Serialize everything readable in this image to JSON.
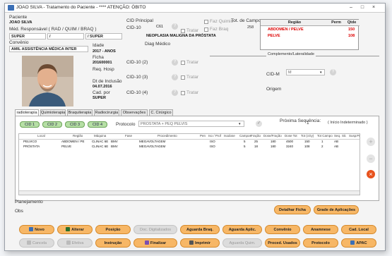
{
  "window": {
    "title": "JOAO SILVA - Tratamento do Paciente - **** ATENÇÃO: ÓBITO"
  },
  "patient": {
    "label": "Paciente",
    "name": "JOAO SILVA",
    "med_label": "Méd. Responsável ( RAD / QUIM / BRAQ )",
    "med1": "SUPER",
    "med2": "/",
    "med3": "/ SUPER",
    "convenio_label": "Convênio",
    "convenio": "AMIL ASSISTÊNCIA MÉDICA INTER",
    "idade_label": "Idade",
    "idade": "2017 - ANOS",
    "ficha_label": "Ficha",
    "ficha": "201600001",
    "req_label": "Req. Hosp",
    "dt_label": "Dt de Inclusão",
    "dt": "04.07.2016",
    "cad_label": "Cad. por",
    "cad": "SUPER"
  },
  "cid": {
    "principal_label": "CID Principal",
    "cid10_label": "CID-10",
    "code": "C61",
    "tratar": "Tratar",
    "faz_quimio": "Faz Quimio",
    "faz_braq": "Faz Braq",
    "desc": "NEOPLASIA MALIGNA DA PRÓSTATA",
    "diag_label": "Diag Médico",
    "cid2": "CID-10 (2)",
    "cid3": "CID-10 (3)",
    "cid4": "CID-10 (4)"
  },
  "campos": {
    "label": "Tot. de Campos",
    "value": "258"
  },
  "regiao_table": {
    "headers": [
      "Região",
      "Perm",
      "Qtde"
    ],
    "rows": [
      {
        "regiao": "ABDOMEN / PELVE",
        "qtde": "150"
      },
      {
        "regiao": "PELVE",
        "qtde": "108"
      }
    ]
  },
  "complemento": {
    "label": "Complemento/Lateralidade",
    "cidm_label": "CID-M",
    "cidm_value": "M",
    "origem_label": "Origem"
  },
  "tabs": [
    "radioterapia",
    "Quimioterapia",
    "Braquiterapia",
    "Radiocirurgia",
    "Observações",
    "C. Cirúrgico"
  ],
  "cid_buttons": [
    "CID 1",
    "CID 2",
    "CID 3",
    "CID 4"
  ],
  "protocolo": {
    "label": "Protocolo",
    "value": "PROSTATA + PEQ PELVIS",
    "seq_label": "Próxima Sequência:",
    "seq_value": "1",
    "seq_note": "( Início Indeterminado )"
  },
  "grid": {
    "headers": [
      "Local",
      "Região",
      "Máquina",
      "Fase",
      "Procedimento",
      "Pen",
      "Iso / Prof",
      "Isodose",
      "Campos",
      "Fração",
      "Dose/Fração",
      "Dose Tot",
      "Tot (cGy)",
      "Tot Campo",
      "Seq.",
      "Sit.",
      "Susp.",
      "Pr"
    ],
    "rows": [
      [
        "PELVICO",
        "ABDOMEN / PE",
        "CLINAC 6E",
        "BMV",
        "MEGAVOLTAGEM",
        "",
        "ISO",
        "",
        "5",
        "25",
        "180",
        "4500",
        "150",
        "1",
        "AB",
        "",
        ""
      ],
      [
        "PRÓSTATA",
        "PELVE",
        "CLINAC 6E",
        "BMV",
        "MEGAVOLTAGEM",
        "",
        "ISO",
        "",
        "5",
        "18",
        "180",
        "3240",
        "108",
        "2",
        "AB",
        "",
        ""
      ]
    ]
  },
  "bottom": {
    "planejamento": "Planejamento",
    "obs": "Obs",
    "detalhar": "Detalhar Ficha",
    "grade": "Grade de Aplicações"
  },
  "actions_row1": [
    "Novo",
    "Alterar",
    "Posição",
    "Doc. Digitalizados",
    "Aguarda Braq.",
    "Aguarda Aplic.",
    "Convênio",
    "Anamnese",
    "Cad. Local"
  ],
  "actions_row2": [
    "Cancela",
    "Efetiva",
    "Instrução",
    "Finalizar",
    "Imprimir",
    "Aguarda Quim.",
    "Proced. Usados",
    "Protocolo",
    "APAC"
  ],
  "colors": {
    "accent": "#f7b766",
    "cid_green": "#b6dfa5",
    "alert_red": "#d00000"
  }
}
